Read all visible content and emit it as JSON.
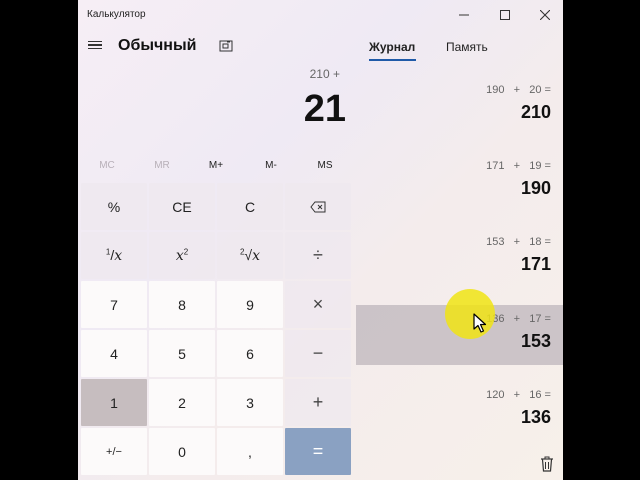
{
  "window": {
    "title": "Калькулятор"
  },
  "header": {
    "mode": "Обычный"
  },
  "display": {
    "expression": "210 +",
    "value": "21"
  },
  "memory": {
    "mc": "MC",
    "mr": "MR",
    "mplus": "M+",
    "mminus": "M-",
    "ms": "MS"
  },
  "keys": {
    "percent": "%",
    "ce": "CE",
    "c": "C",
    "square": "2",
    "divide": "÷",
    "k7": "7",
    "k8": "8",
    "k9": "9",
    "multiply": "×",
    "k4": "4",
    "k5": "5",
    "k6": "6",
    "minus": "−",
    "k1": "1",
    "k2": "2",
    "k3": "3",
    "plus": "+",
    "negate": "+/−",
    "k0": "0",
    "decimal": ",",
    "equals": "="
  },
  "tabs": {
    "journal": "Журнал",
    "memory": "Память"
  },
  "history": [
    {
      "expr": "190   +   20 =",
      "result": "210"
    },
    {
      "expr": "171   +   19 =",
      "result": "190"
    },
    {
      "expr": "153   +   18 =",
      "result": "171"
    },
    {
      "expr": "136   +   17 =",
      "result": "153"
    },
    {
      "expr": "120   +   16 =",
      "result": "136"
    }
  ],
  "colors": {
    "accent": "#1f5aa8",
    "equals_key": "#8aa1c2",
    "cursor_halo": "#f0e414"
  }
}
